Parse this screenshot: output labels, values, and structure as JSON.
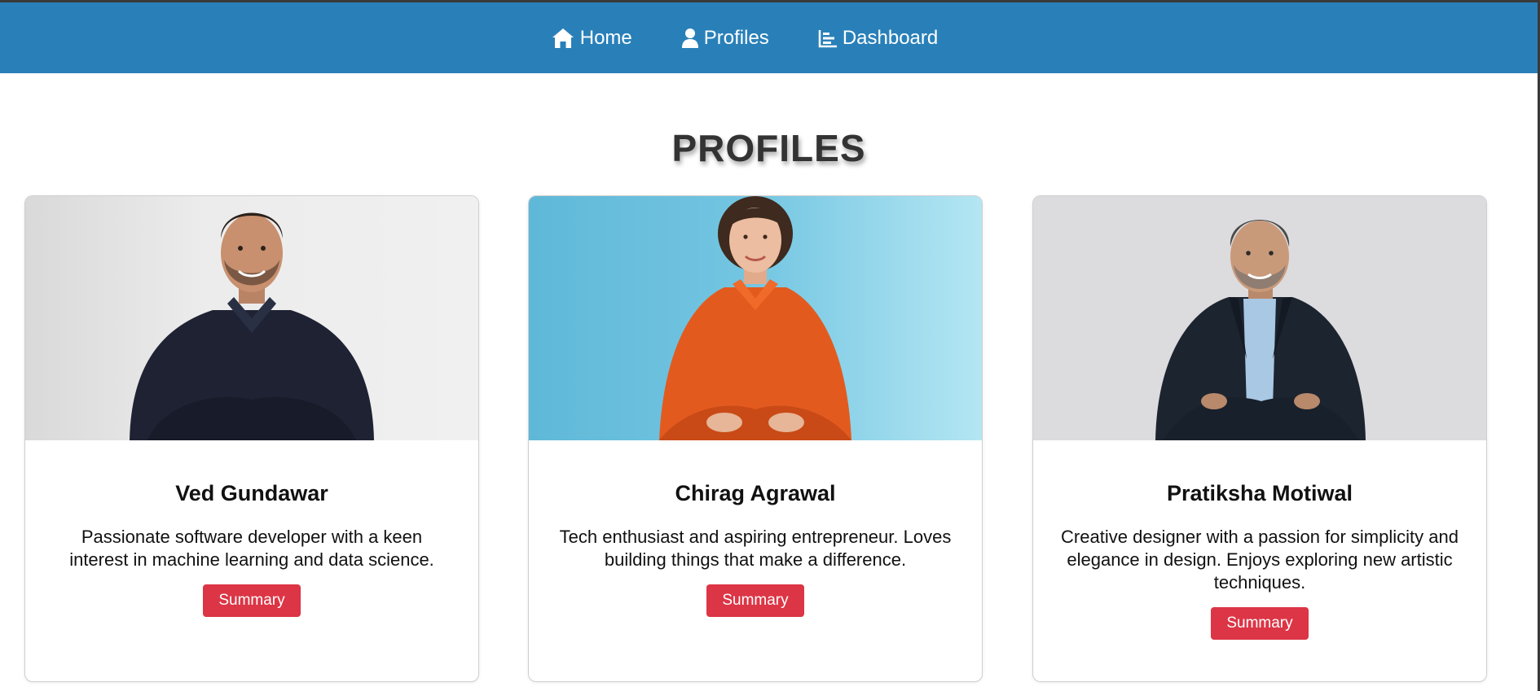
{
  "nav": {
    "items": [
      {
        "label": "Home",
        "icon": "home-icon"
      },
      {
        "label": "Profiles",
        "icon": "user-icon"
      },
      {
        "label": "Dashboard",
        "icon": "chart-bar-icon"
      }
    ]
  },
  "page": {
    "title": "PROFILES"
  },
  "profiles": [
    {
      "name": "Ved Gundawar",
      "bio": "Passionate software developer with a keen interest in machine learning and data science.",
      "button": "Summary"
    },
    {
      "name": "Chirag Agrawal",
      "bio": "Tech enthusiast and aspiring entrepreneur. Loves building things that make a difference.",
      "button": "Summary"
    },
    {
      "name": "Pratiksha Motiwal",
      "bio": "Creative designer with a passion for simplicity and elegance in design. Enjoys exploring new artistic techniques.",
      "button": "Summary"
    }
  ],
  "colors": {
    "navbar": "#2980b9",
    "button": "#dc3545",
    "heading": "#333333"
  }
}
